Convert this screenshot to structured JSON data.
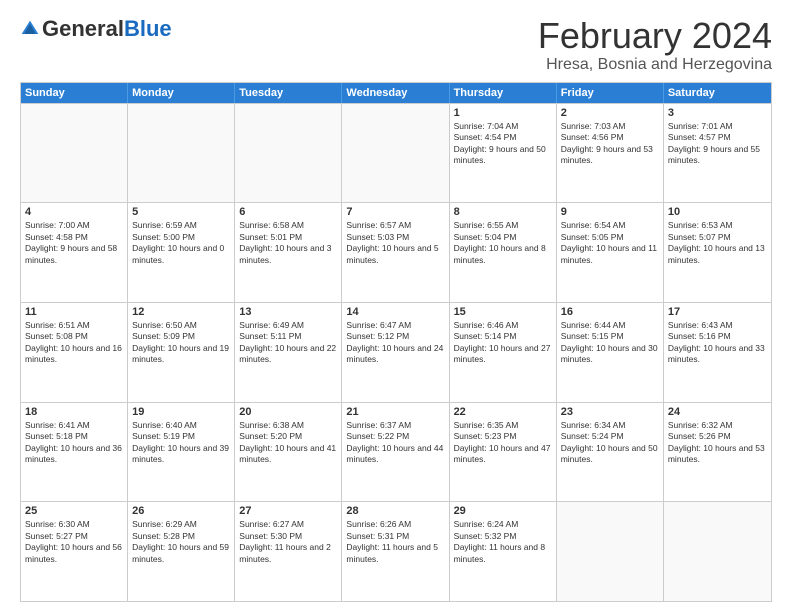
{
  "header": {
    "logo_general": "General",
    "logo_blue": "Blue",
    "month_title": "February 2024",
    "location": "Hresa, Bosnia and Herzegovina"
  },
  "days_of_week": [
    "Sunday",
    "Monday",
    "Tuesday",
    "Wednesday",
    "Thursday",
    "Friday",
    "Saturday"
  ],
  "weeks": [
    [
      {
        "day": "",
        "empty": true
      },
      {
        "day": "",
        "empty": true
      },
      {
        "day": "",
        "empty": true
      },
      {
        "day": "",
        "empty": true
      },
      {
        "day": "1",
        "sunrise": "7:04 AM",
        "sunset": "4:54 PM",
        "daylight": "9 hours and 50 minutes."
      },
      {
        "day": "2",
        "sunrise": "7:03 AM",
        "sunset": "4:56 PM",
        "daylight": "9 hours and 53 minutes."
      },
      {
        "day": "3",
        "sunrise": "7:01 AM",
        "sunset": "4:57 PM",
        "daylight": "9 hours and 55 minutes."
      }
    ],
    [
      {
        "day": "4",
        "sunrise": "7:00 AM",
        "sunset": "4:58 PM",
        "daylight": "9 hours and 58 minutes."
      },
      {
        "day": "5",
        "sunrise": "6:59 AM",
        "sunset": "5:00 PM",
        "daylight": "10 hours and 0 minutes."
      },
      {
        "day": "6",
        "sunrise": "6:58 AM",
        "sunset": "5:01 PM",
        "daylight": "10 hours and 3 minutes."
      },
      {
        "day": "7",
        "sunrise": "6:57 AM",
        "sunset": "5:03 PM",
        "daylight": "10 hours and 5 minutes."
      },
      {
        "day": "8",
        "sunrise": "6:55 AM",
        "sunset": "5:04 PM",
        "daylight": "10 hours and 8 minutes."
      },
      {
        "day": "9",
        "sunrise": "6:54 AM",
        "sunset": "5:05 PM",
        "daylight": "10 hours and 11 minutes."
      },
      {
        "day": "10",
        "sunrise": "6:53 AM",
        "sunset": "5:07 PM",
        "daylight": "10 hours and 13 minutes."
      }
    ],
    [
      {
        "day": "11",
        "sunrise": "6:51 AM",
        "sunset": "5:08 PM",
        "daylight": "10 hours and 16 minutes."
      },
      {
        "day": "12",
        "sunrise": "6:50 AM",
        "sunset": "5:09 PM",
        "daylight": "10 hours and 19 minutes."
      },
      {
        "day": "13",
        "sunrise": "6:49 AM",
        "sunset": "5:11 PM",
        "daylight": "10 hours and 22 minutes."
      },
      {
        "day": "14",
        "sunrise": "6:47 AM",
        "sunset": "5:12 PM",
        "daylight": "10 hours and 24 minutes."
      },
      {
        "day": "15",
        "sunrise": "6:46 AM",
        "sunset": "5:14 PM",
        "daylight": "10 hours and 27 minutes."
      },
      {
        "day": "16",
        "sunrise": "6:44 AM",
        "sunset": "5:15 PM",
        "daylight": "10 hours and 30 minutes."
      },
      {
        "day": "17",
        "sunrise": "6:43 AM",
        "sunset": "5:16 PM",
        "daylight": "10 hours and 33 minutes."
      }
    ],
    [
      {
        "day": "18",
        "sunrise": "6:41 AM",
        "sunset": "5:18 PM",
        "daylight": "10 hours and 36 minutes."
      },
      {
        "day": "19",
        "sunrise": "6:40 AM",
        "sunset": "5:19 PM",
        "daylight": "10 hours and 39 minutes."
      },
      {
        "day": "20",
        "sunrise": "6:38 AM",
        "sunset": "5:20 PM",
        "daylight": "10 hours and 41 minutes."
      },
      {
        "day": "21",
        "sunrise": "6:37 AM",
        "sunset": "5:22 PM",
        "daylight": "10 hours and 44 minutes."
      },
      {
        "day": "22",
        "sunrise": "6:35 AM",
        "sunset": "5:23 PM",
        "daylight": "10 hours and 47 minutes."
      },
      {
        "day": "23",
        "sunrise": "6:34 AM",
        "sunset": "5:24 PM",
        "daylight": "10 hours and 50 minutes."
      },
      {
        "day": "24",
        "sunrise": "6:32 AM",
        "sunset": "5:26 PM",
        "daylight": "10 hours and 53 minutes."
      }
    ],
    [
      {
        "day": "25",
        "sunrise": "6:30 AM",
        "sunset": "5:27 PM",
        "daylight": "10 hours and 56 minutes."
      },
      {
        "day": "26",
        "sunrise": "6:29 AM",
        "sunset": "5:28 PM",
        "daylight": "10 hours and 59 minutes."
      },
      {
        "day": "27",
        "sunrise": "6:27 AM",
        "sunset": "5:30 PM",
        "daylight": "11 hours and 2 minutes."
      },
      {
        "day": "28",
        "sunrise": "6:26 AM",
        "sunset": "5:31 PM",
        "daylight": "11 hours and 5 minutes."
      },
      {
        "day": "29",
        "sunrise": "6:24 AM",
        "sunset": "5:32 PM",
        "daylight": "11 hours and 8 minutes."
      },
      {
        "day": "",
        "empty": true
      },
      {
        "day": "",
        "empty": true
      }
    ]
  ],
  "labels": {
    "sunrise_prefix": "Sunrise: ",
    "sunset_prefix": "Sunset: ",
    "daylight_label": "Daylight hours"
  }
}
